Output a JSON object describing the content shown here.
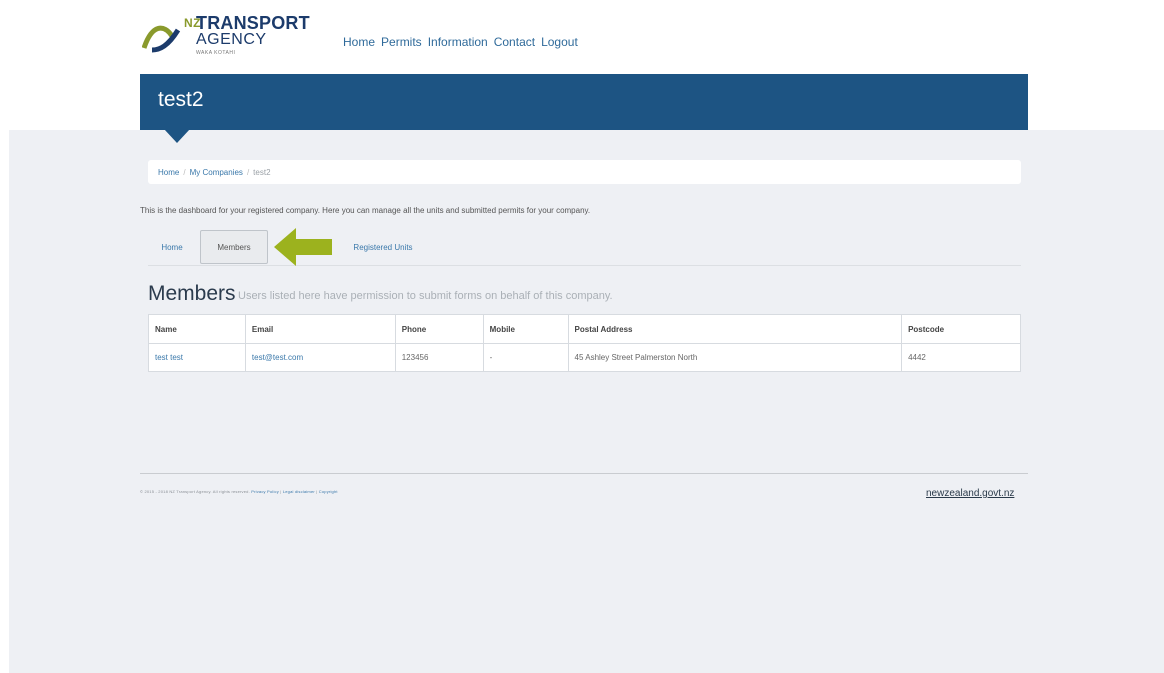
{
  "header": {
    "logo": {
      "nz": "NZ",
      "line1": "TRANSPORT",
      "line2": "AGENCY",
      "sub": "WAKA KOTAHI"
    },
    "nav": [
      "Home",
      "Permits",
      "Information",
      "Contact",
      "Logout"
    ]
  },
  "banner": {
    "title": "test2",
    "color": "#1d5483"
  },
  "breadcrumb": {
    "items": [
      "Home",
      "My Companies",
      "test2"
    ]
  },
  "intro": "This is the dashboard for your registered company. Here you can manage all the units and submitted permits for your company.",
  "tabs": [
    "Home",
    "Members",
    "Registered Units"
  ],
  "annotation": {
    "arrow_color": "#9cb21e",
    "arrow_icon": "left-arrow-icon"
  },
  "members": {
    "title": "Members",
    "subtitle": "Users listed here have permission to submit forms on behalf of this company.",
    "columns": [
      "Name",
      "Email",
      "Phone",
      "Mobile",
      "Postal Address",
      "Postcode"
    ],
    "rows": [
      [
        "test test",
        "test@test.com",
        "123456",
        "-",
        "45 Ashley Street Palmerston North",
        "4442"
      ]
    ]
  },
  "footer": {
    "copyright": "© 2015 - 2018 NZ Transport Agency. All rights reserved.",
    "links": [
      "Privacy Policy",
      "Legal disclaimer",
      "Copyright"
    ],
    "govt": "newzealand.govt.nz"
  }
}
